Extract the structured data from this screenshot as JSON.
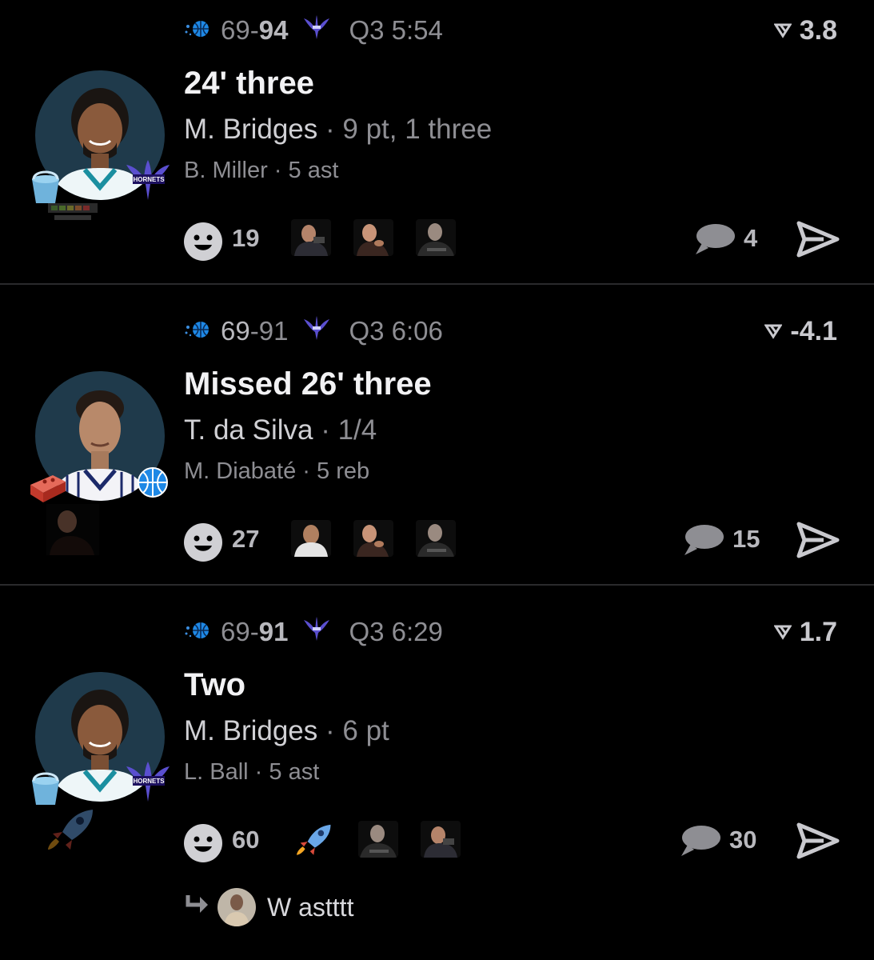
{
  "colors": {
    "background": "#000000",
    "avatar_bg": "#1f3a4b",
    "muted": "#8e8e93",
    "divider": "#2a2a2c"
  },
  "plays": [
    {
      "score_home": "69",
      "score_away": "94",
      "clock": "Q3 5:54",
      "delta": "3.8",
      "title": "24' three",
      "player": "M. Bridges",
      "player_stat": "9 pt, 1 three",
      "assist_player": "B. Miller",
      "assist_stat": "5 ast",
      "reactions": "19",
      "comments": "4",
      "left_badge_icon": "bucket-icon",
      "right_badge_icon": "hornets-logo-icon"
    },
    {
      "score_home": "69",
      "score_away": "91",
      "clock": "Q3 6:06",
      "delta": "-4.1",
      "title": "Missed 26' three",
      "player": "T. da Silva",
      "player_stat": "1/4",
      "assist_player": "M. Diabaté",
      "assist_stat": "5 reb",
      "reactions": "27",
      "comments": "15",
      "left_badge_icon": "brick-icon",
      "right_badge_icon": "magic-logo-icon"
    },
    {
      "score_home": "69",
      "score_away": "91",
      "clock": "Q3 6:29",
      "delta": "1.7",
      "title": "Two",
      "player": "M. Bridges",
      "player_stat": "6 pt",
      "assist_player": "L. Ball",
      "assist_stat": "5 ast",
      "reactions": "60",
      "comments": "30",
      "left_badge_icon": "bucket-icon",
      "right_badge_icon": "hornets-logo-icon"
    }
  ],
  "reply": {
    "text": "W astttt"
  },
  "separator": "·",
  "logo_text": {
    "hornets": "HORNETS"
  }
}
